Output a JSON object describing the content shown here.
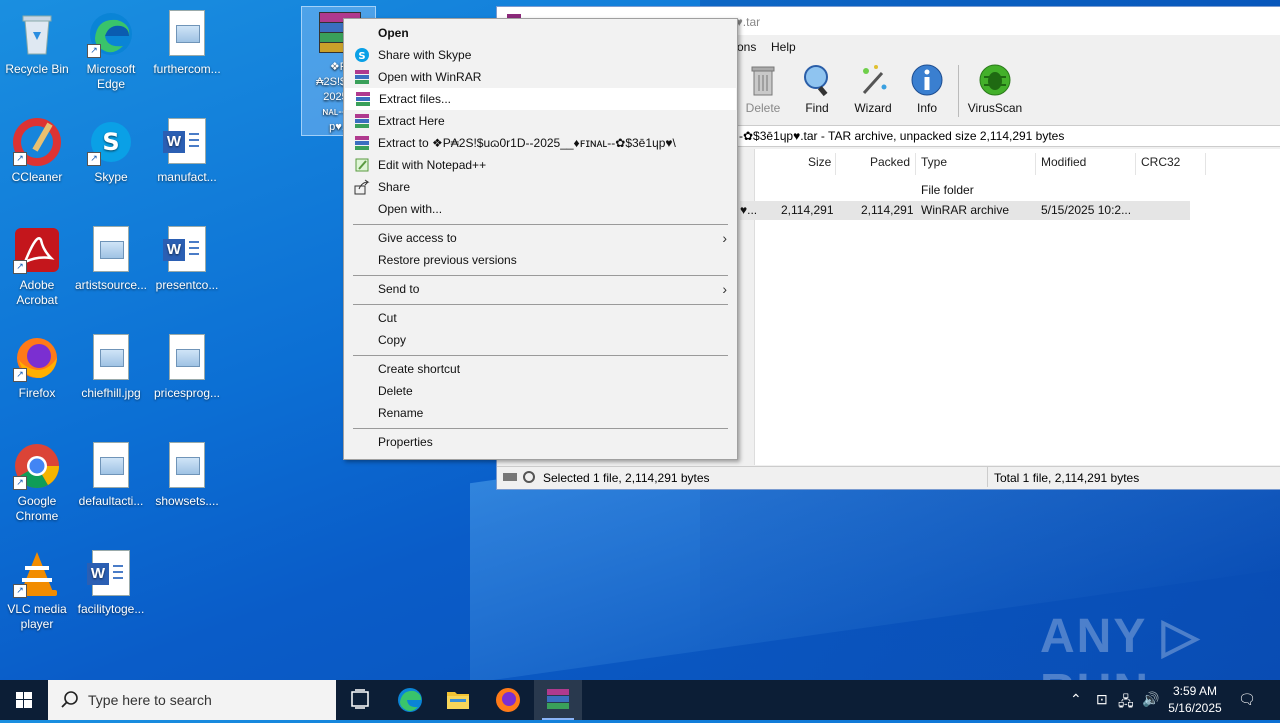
{
  "desktop": {
    "icons": [
      {
        "label": "Recycle Bin"
      },
      {
        "label": "Microsoft Edge"
      },
      {
        "label": "furthercom..."
      },
      {
        "label": "CCleaner"
      },
      {
        "label": "Skype"
      },
      {
        "label": "manufact..."
      },
      {
        "label": "Adobe Acrobat"
      },
      {
        "label": "artistsource..."
      },
      {
        "label": "presentco..."
      },
      {
        "label": "Firefox"
      },
      {
        "label": "chiefhill.jpg"
      },
      {
        "label": "pricesprog..."
      },
      {
        "label": "Google Chrome"
      },
      {
        "label": "defaultacti..."
      },
      {
        "label": "showsets...."
      },
      {
        "label": "VLC media player"
      },
      {
        "label": "facilitytoge..."
      }
    ],
    "selected_icon": {
      "line1": "❖P",
      "line2": "₳2S!$uɷ",
      "line3": "2025_",
      "line4": "ɴᴀʟ--✿",
      "line5": "p♥.t"
    }
  },
  "winrar": {
    "title": "❖P₳2S!$uɷ0r1D--2025_♦ꜰɪɴᴀʟ--✿$3ē1ɥp♥.tar",
    "title_visible": "p♥.tar",
    "menu": {
      "options": "ons",
      "help": "Help"
    },
    "toolbar": [
      {
        "label": "Delete"
      },
      {
        "label": "Find"
      },
      {
        "label": "Wizard"
      },
      {
        "label": "Info"
      },
      {
        "label": "VirusScan"
      }
    ],
    "path": "-✿$3ē1ɥp♥.tar - TAR archive, unpacked size 2,114,291 bytes",
    "columns": [
      "Size",
      "Packed",
      "Type",
      "Modified",
      "CRC32"
    ],
    "rows": [
      {
        "name": "",
        "size": "",
        "packed": "",
        "type": "File folder",
        "modified": "",
        "crc": ""
      },
      {
        "name": "♥...",
        "size": "2,114,291",
        "packed": "2,114,291",
        "type": "WinRAR archive",
        "modified": "5/15/2025 10:2...",
        "crc": ""
      }
    ],
    "status_left": "Selected 1 file, 2,114,291 bytes",
    "status_right": "Total 1 file, 2,114,291 bytes"
  },
  "context_menu": {
    "items": [
      {
        "label": "Open"
      },
      {
        "label": "Share with Skype"
      },
      {
        "label": "Open with WinRAR"
      },
      {
        "label": "Extract files..."
      },
      {
        "label": "Extract Here"
      },
      {
        "label": "Extract to ❖P₳2S!$uɷ0r1D--2025__♦ꜰɪɴᴀʟ--✿$3ē1ɥp♥\\"
      },
      {
        "label": "Edit with Notepad++"
      },
      {
        "label": "Share"
      },
      {
        "label": "Open with..."
      },
      {
        "label": "Give access to"
      },
      {
        "label": "Restore previous versions"
      },
      {
        "label": "Send to"
      },
      {
        "label": "Cut"
      },
      {
        "label": "Copy"
      },
      {
        "label": "Create shortcut"
      },
      {
        "label": "Delete"
      },
      {
        "label": "Rename"
      },
      {
        "label": "Properties"
      }
    ]
  },
  "watermark": "ANY ▷ RUN",
  "taskbar": {
    "search_placeholder": "Type here to search",
    "time": "3:59 AM",
    "date": "5/16/2025"
  },
  "colors": {
    "desktop": "#0c6fd4",
    "taskbar": "#0c1e36",
    "menu_bg": "#f2f2f2"
  }
}
